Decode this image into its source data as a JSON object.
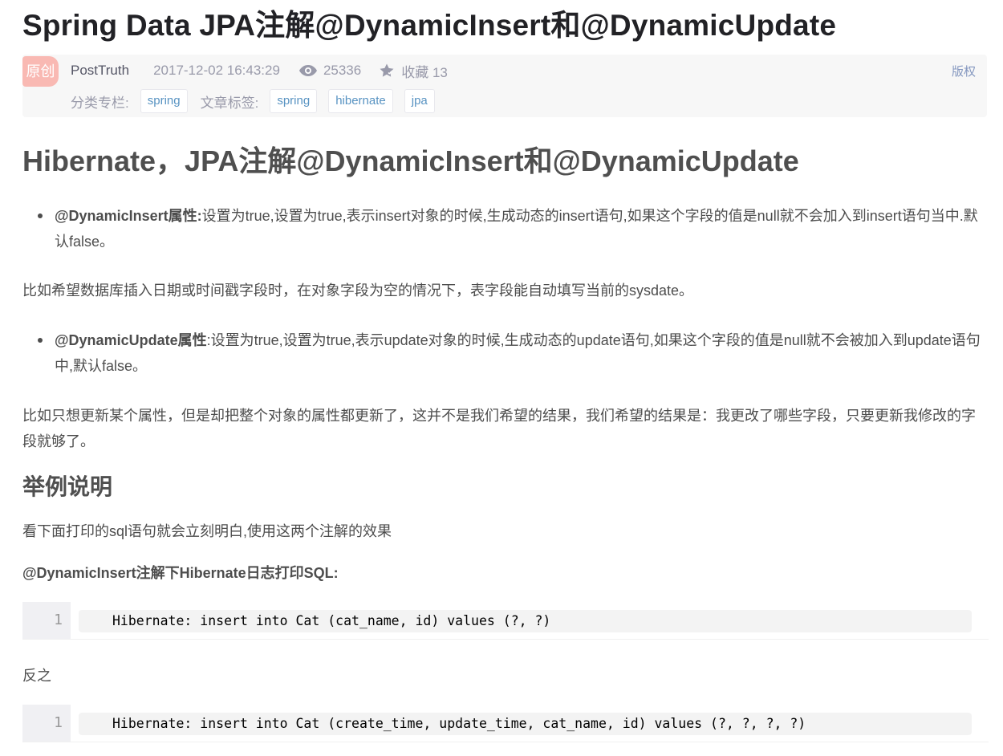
{
  "article": {
    "title": "Spring Data JPA注解@DynamicInsert和@DynamicUpdate"
  },
  "meta": {
    "badge": "原创",
    "author": "PostTruth",
    "date": "2017-12-02 16:43:29",
    "views": "25336",
    "favorite": "收藏 13",
    "copyright": "版权",
    "category_label": "分类专栏:",
    "categories": [
      "spring"
    ],
    "tags_label": "文章标签:",
    "tags": [
      "spring",
      "hibernate",
      "jpa"
    ]
  },
  "content": {
    "h1": "Hibernate，JPA注解@DynamicInsert和@DynamicUpdate",
    "bullet1_bold": "@DynamicInsert属性:",
    "bullet1_text": "设置为true,设置为true,表示insert对象的时候,生成动态的insert语句,如果这个字段的值是null就不会加入到insert语句当中.默认false。",
    "para1": "比如希望数据库插入日期或时间戳字段时，在对象字段为空的情况下，表字段能自动填写当前的sysdate。",
    "bullet2_bold": "@DynamicUpdate属性",
    "bullet2_text": ":设置为true,设置为true,表示update对象的时候,生成动态的update语句,如果这个字段的值是null就不会被加入到update语句中,默认false。",
    "para2": "比如只想更新某个属性，但是却把整个对象的属性都更新了，这并不是我们希望的结果，我们希望的结果是：我更改了哪些字段，只要更新我修改的字段就够了。",
    "h2": "举例说明",
    "para3": "看下面打印的sql语句就会立刻明白,使用这两个注解的效果",
    "para4": "@DynamicInsert注解下Hibernate日志打印SQL:",
    "code1_num": "1",
    "code1": "Hibernate: insert into Cat (cat_name, id) values (?, ?)",
    "para5": "反之",
    "code2_num": "1",
    "code2": "Hibernate: insert into Cat (create_time, update_time, cat_name, id) values (?, ?, ?, ?)"
  }
}
